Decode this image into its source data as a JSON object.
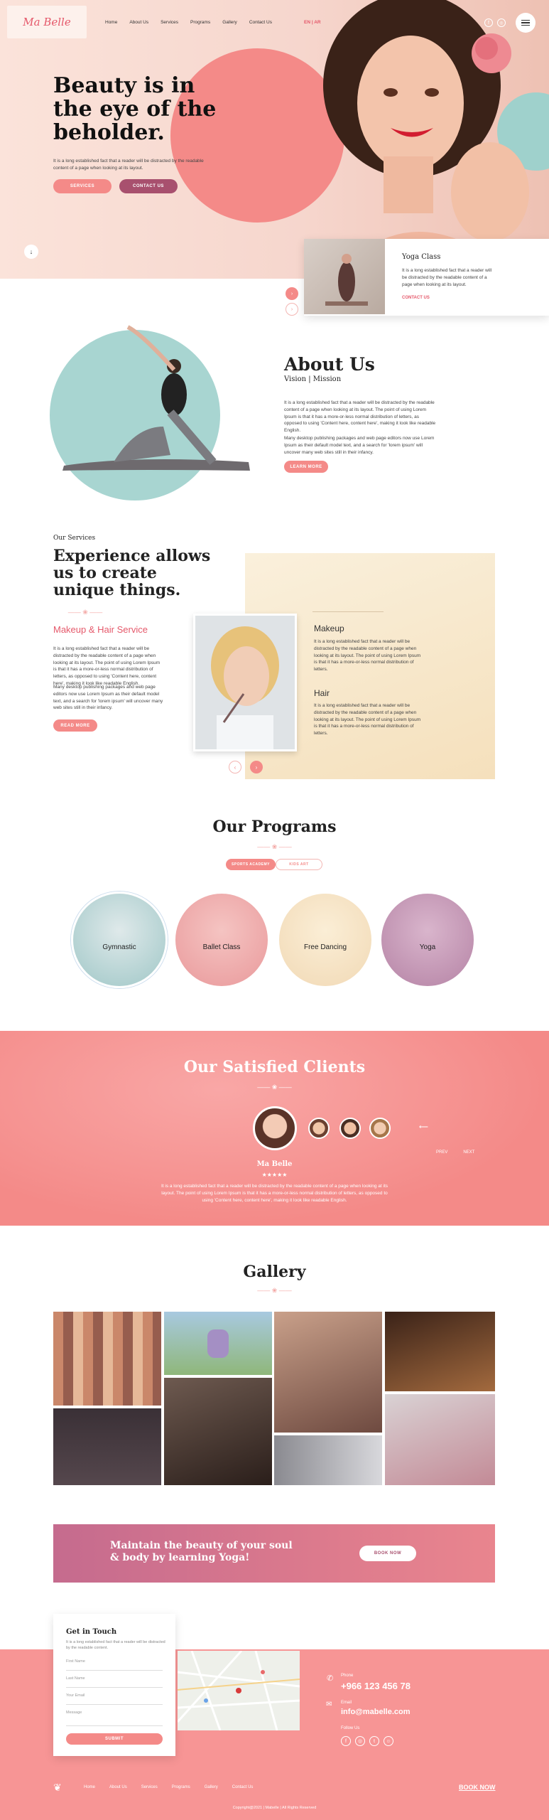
{
  "brand": {
    "logo": "Ma Belle",
    "lang": "EN | AR"
  },
  "nav": [
    "Home",
    "About Us",
    "Services",
    "Programs",
    "Gallery",
    "Contact Us"
  ],
  "hero": {
    "title_l1": "Beauty is in",
    "title_l2": "the eye of the",
    "title_l3": "beholder.",
    "text": "It is a long established fact that a reader will be distracted by the readable content of a page when looking at its layout.",
    "btn1": "SERVICES",
    "btn2": "CONTACT US"
  },
  "yoga_card": {
    "title": "Yoga Class",
    "text": "It is a long established fact that a reader will be distracted by the readable content of a page when looking at its layout.",
    "link": "CONTACT US"
  },
  "about": {
    "title": "About Us",
    "sub1": "Vision",
    "sub2": "Mission",
    "p1": "It is a long established fact that a reader will be distracted by the readable content of a page when looking at its layout. The point of using Lorem Ipsum is that it has a more-or-less normal distribution of letters, as opposed to using 'Content here, content here', making it look like readable English.",
    "p2": "Many desktop publishing packages and web page editors now use Lorem Ipsum as their default model text, and a search for 'lorem ipsum' will uncover many web sites still in their infancy.",
    "btn": "LEARN MORE"
  },
  "services": {
    "label": "Our Services",
    "title_l1": "Experience allows",
    "title_l2": "us to create",
    "title_l3": "unique things.",
    "sub": "Makeup & Hair Service",
    "p1": "It is a long established fact that a reader will be distracted by the readable content of a page when looking at its layout. The point of using Lorem Ipsum is that it has a more-or-less normal distribution of letters, as opposed to using 'Content here, content here', making it look like readable English.",
    "p2": "Many desktop publishing packages and web page editors now use Lorem Ipsum as their default model text, and a search for 'lorem ipsum' will uncover many web sites still in their infancy.",
    "btn": "READ MORE",
    "makeup_title": "Makeup",
    "makeup_text": "It is a long established fact that a reader will be distracted by the readable content of a page when looking at its layout. The point of using Lorem Ipsum is that it has a more-or-less normal distribution of letters.",
    "hair_title": "Hair",
    "hair_text": "It is a long established fact that a reader will be distracted by the readable content of a page when looking at its layout. The point of using Lorem Ipsum is that it has a more-or-less normal distribution of letters."
  },
  "programs": {
    "title": "Our Programs",
    "tab1": "SPORTS ACADEMY",
    "tab2": "KIDS ART",
    "items": [
      "Gymnastic",
      "Ballet Class",
      "Free Dancing",
      "Yoga"
    ]
  },
  "clients": {
    "title": "Our Satisfied Clients",
    "name": "Ma Belle",
    "stars": "★★★★★",
    "text": "It is a long established fact that a reader will be distracted by the readable content of a page when looking at its layout. The point of using Lorem Ipsum is that it has a more-or-less normal distribution of letters, as opposed to using 'Content here, content here', making it look like readable English.",
    "prev": "PREV",
    "next": "NEXT"
  },
  "gallery": {
    "title": "Gallery"
  },
  "banner": {
    "line1": "Maintain the beauty of your soul",
    "line2": "& body by learning Yoga!",
    "btn": "BOOK NOW"
  },
  "contact": {
    "title": "Get in Touch",
    "text": "It is a long established fact that a reader will be distracted by the readable content.",
    "first": "First Name",
    "last": "Last Name",
    "email": "Your Email",
    "message": "Message",
    "submit": "SUBMIT"
  },
  "info": {
    "phone_label": "Phone",
    "phone": "+966 123 456 78",
    "email_label": "Email",
    "email": "info@mabelle.com",
    "follow": "Follow Us"
  },
  "footer": {
    "links": [
      "Home",
      "About Us",
      "Services",
      "Programs",
      "Gallery",
      "Contact Us"
    ],
    "book": "BOOK NOW",
    "copy": "Copyright@2021 | Mabelle | All Rights Reserved"
  },
  "colors": {
    "accent": "#f28a8a",
    "plum": "#a8506e",
    "mint": "#a8d5d1",
    "cream": "#f7e6c6"
  }
}
